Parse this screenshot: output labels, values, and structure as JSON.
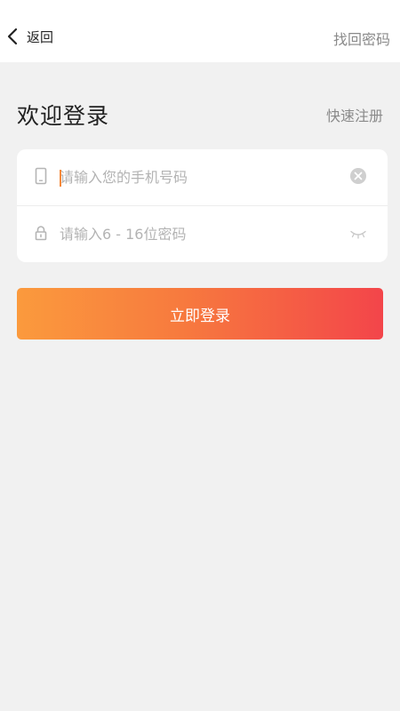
{
  "header": {
    "back_label": "返回",
    "right_link": "找回密码"
  },
  "main": {
    "title": "欢迎登录",
    "register_link": "快速注册"
  },
  "form": {
    "phone_placeholder": "请输入您的手机号码",
    "password_placeholder": "请输入6 - 16位密码",
    "submit_label": "立即登录"
  },
  "icons": {
    "back": "chevron-left-icon",
    "phone": "phone-icon",
    "clear": "clear-icon",
    "lock": "lock-icon",
    "eye": "eye-closed-icon"
  },
  "colors": {
    "accent_start": "#fb9a3d",
    "accent_end": "#f3454a",
    "caret": "#f5893a"
  }
}
